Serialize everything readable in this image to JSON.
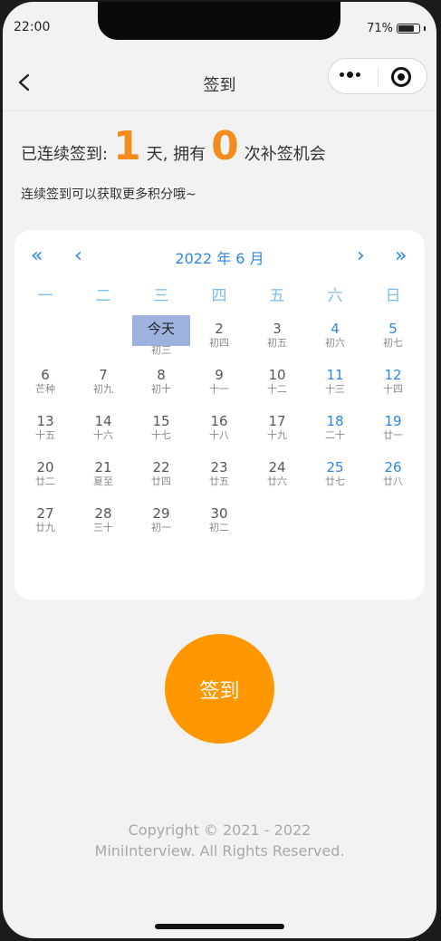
{
  "status": {
    "time": "22:00",
    "battery": "71%"
  },
  "navbar": {
    "title": "签到"
  },
  "summary": {
    "prefix": "已连续签到:",
    "streak": "1",
    "mid": "天, 拥有",
    "makeups": "0",
    "suffix": "次补签机会",
    "hint": "连续签到可以获取更多积分哦~"
  },
  "calendar": {
    "month_label": "2022 年 6 月",
    "nav": {
      "prev_year": "«",
      "prev_month": "‹",
      "next_month": "›",
      "next_year": "»"
    },
    "weekdays": [
      "一",
      "二",
      "三",
      "四",
      "五",
      "六",
      "日"
    ],
    "days": [
      {
        "d": "",
        "l": ""
      },
      {
        "d": "",
        "l": ""
      },
      {
        "d": "今天",
        "l": "初三",
        "today": true
      },
      {
        "d": "2",
        "l": "初四"
      },
      {
        "d": "3",
        "l": "初五"
      },
      {
        "d": "4",
        "l": "初六",
        "weekend": true
      },
      {
        "d": "5",
        "l": "初七",
        "weekend": true
      },
      {
        "d": "6",
        "l": "芒种"
      },
      {
        "d": "7",
        "l": "初九"
      },
      {
        "d": "8",
        "l": "初十"
      },
      {
        "d": "9",
        "l": "十一"
      },
      {
        "d": "10",
        "l": "十二"
      },
      {
        "d": "11",
        "l": "十三",
        "weekend": true
      },
      {
        "d": "12",
        "l": "十四",
        "weekend": true
      },
      {
        "d": "13",
        "l": "十五"
      },
      {
        "d": "14",
        "l": "十六"
      },
      {
        "d": "15",
        "l": "十七"
      },
      {
        "d": "16",
        "l": "十八"
      },
      {
        "d": "17",
        "l": "十九"
      },
      {
        "d": "18",
        "l": "二十",
        "weekend": true
      },
      {
        "d": "19",
        "l": "廿一",
        "weekend": true
      },
      {
        "d": "20",
        "l": "廿二"
      },
      {
        "d": "21",
        "l": "夏至"
      },
      {
        "d": "22",
        "l": "廿四"
      },
      {
        "d": "23",
        "l": "廿五"
      },
      {
        "d": "24",
        "l": "廿六"
      },
      {
        "d": "25",
        "l": "廿七",
        "weekend": true
      },
      {
        "d": "26",
        "l": "廿八",
        "weekend": true
      },
      {
        "d": "27",
        "l": "廿九"
      },
      {
        "d": "28",
        "l": "三十"
      },
      {
        "d": "29",
        "l": "初一"
      },
      {
        "d": "30",
        "l": "初二"
      }
    ]
  },
  "sign_button": {
    "label": "签到"
  },
  "footer": {
    "line1": "Copyright © 2021 - 2022",
    "line2": "MiniInterview. All Rights Reserved."
  },
  "colors": {
    "accent": "#f28c1e",
    "button": "#ff9800",
    "calendar_blue": "#2f86e0",
    "today_bg": "#9db2de"
  }
}
